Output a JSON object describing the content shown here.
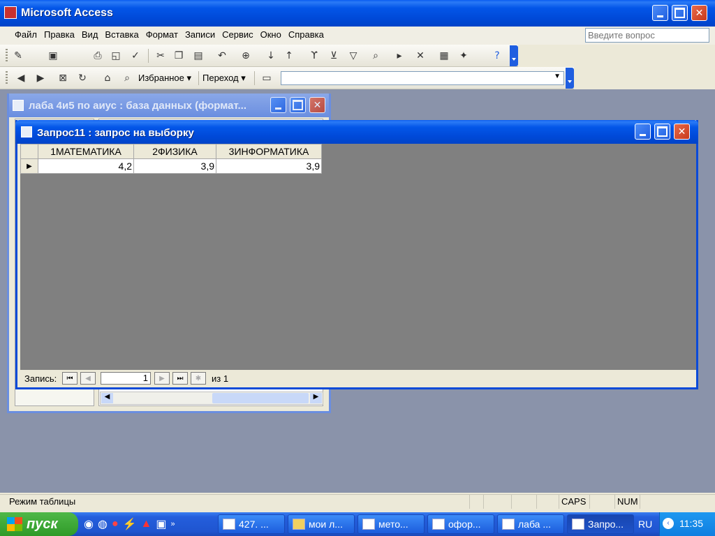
{
  "app": {
    "title": "Microsoft Access"
  },
  "menu": [
    "Файл",
    "Правка",
    "Вид",
    "Вставка",
    "Формат",
    "Записи",
    "Сервис",
    "Окно",
    "Справка"
  ],
  "help": {
    "placeholder": "Введите вопрос"
  },
  "web_toolbar": {
    "favorites": "Избранное",
    "go": "Переход"
  },
  "db_window": {
    "title": "лаба 4и5 по аиус : база данных (формат..."
  },
  "query_window": {
    "title": "Запрос11 : запрос на выборку"
  },
  "datasheet": {
    "columns": [
      "1МАТЕМАТИКА",
      "2ФИЗИКА",
      "3ИНФОРМАТИКА"
    ],
    "rows": [
      [
        "4,2",
        "3,9",
        "3,9"
      ]
    ]
  },
  "nav": {
    "label": "Запись:",
    "current": "1",
    "of_label": "из 1"
  },
  "status": {
    "mode": "Режим таблицы",
    "caps": "CAPS",
    "num": "NUM"
  },
  "taskbar": {
    "start": "пуск",
    "buttons": [
      "427. ...",
      "мои л...",
      "мето...",
      "офор...",
      "лаба ...",
      "Запро..."
    ],
    "lang": "RU",
    "time": "11:35"
  }
}
